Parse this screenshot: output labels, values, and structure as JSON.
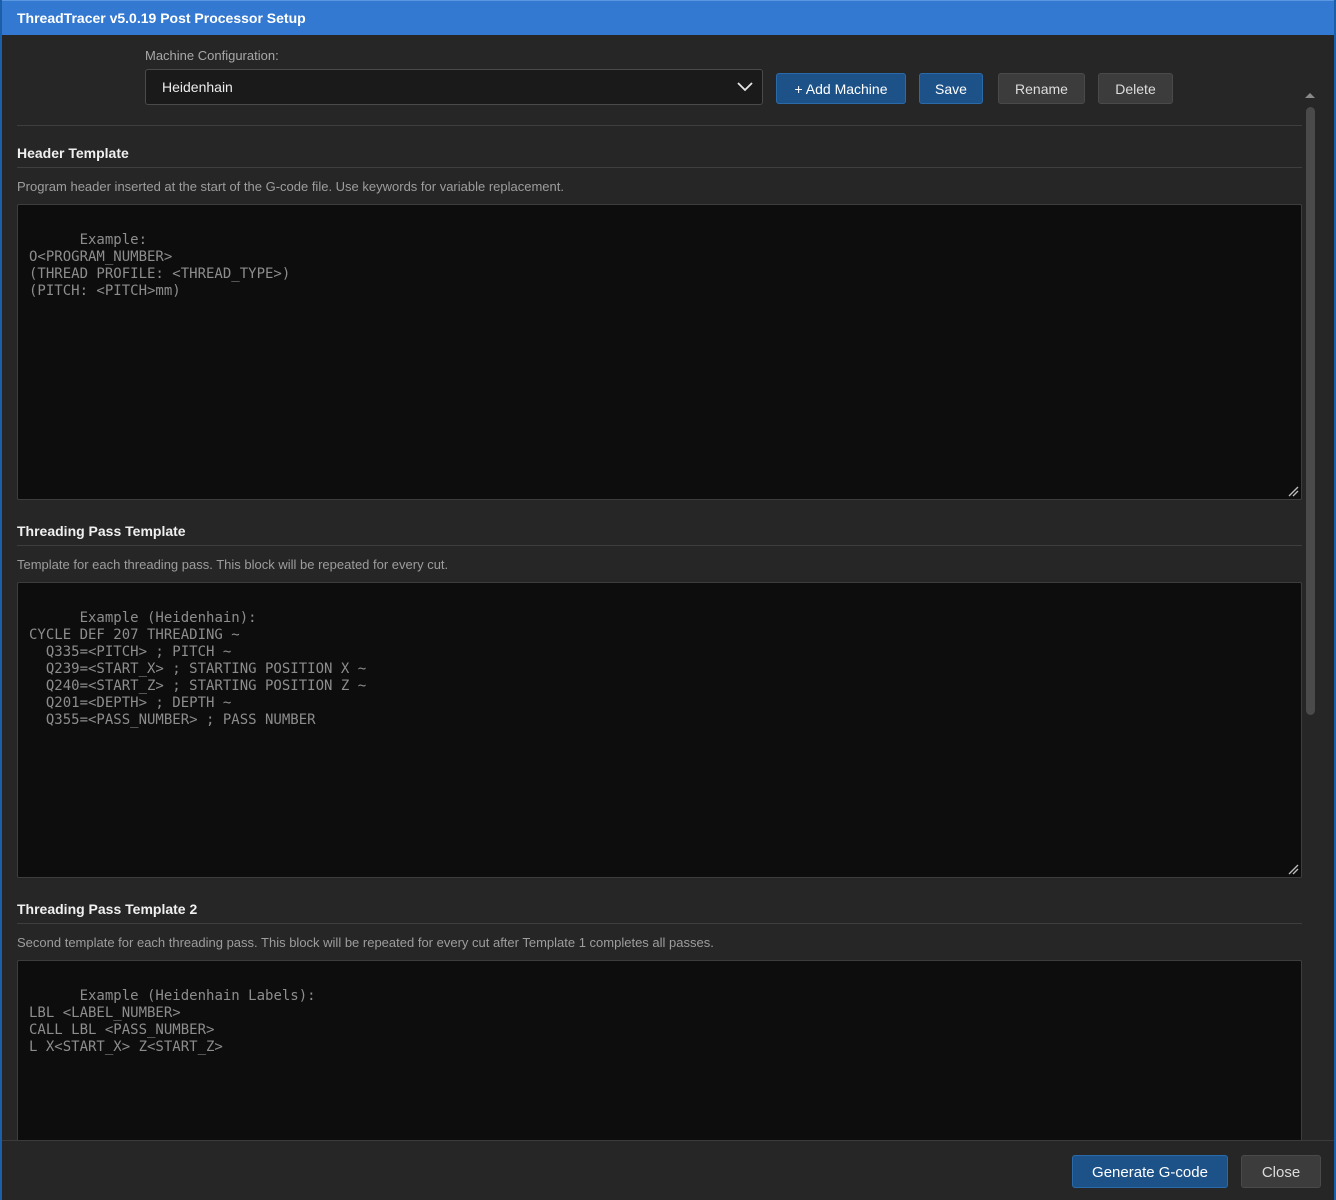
{
  "window": {
    "title": "ThreadTracer v5.0.19 Post Processor Setup"
  },
  "machine_config": {
    "label": "Machine Configuration:",
    "selected": "Heidenhain",
    "add_button": "+ Add Machine",
    "save_button": "Save",
    "rename_button": "Rename",
    "delete_button": "Delete"
  },
  "sections": [
    {
      "title": "Header Template",
      "description": "Program header inserted at the start of the G-code file. Use keywords for variable replacement.",
      "placeholder": "Example:\nO<PROGRAM_NUMBER>\n(THREAD PROFILE: <THREAD_TYPE>)\n(PITCH: <PITCH>mm)"
    },
    {
      "title": "Threading Pass Template",
      "description": "Template for each threading pass. This block will be repeated for every cut.",
      "placeholder": "Example (Heidenhain):\nCYCLE DEF 207 THREADING ~\n  Q335=<PITCH> ; PITCH ~\n  Q239=<START_X> ; STARTING POSITION X ~\n  Q240=<START_Z> ; STARTING POSITION Z ~\n  Q201=<DEPTH> ; DEPTH ~\n  Q355=<PASS_NUMBER> ; PASS NUMBER"
    },
    {
      "title": "Threading Pass Template 2",
      "description": "Second template for each threading pass. This block will be repeated for every cut after Template 1 completes all passes.",
      "placeholder": "Example (Heidenhain Labels):\nLBL <LABEL_NUMBER>\nCALL LBL <PASS_NUMBER>\nL X<START_X> Z<START_Z>"
    }
  ],
  "footer": {
    "generate_button": "Generate G-code",
    "close_button": "Close"
  },
  "icons": {
    "dropdown": "chevron-down-icon",
    "resize": "resize-grip-icon",
    "scroll_up": "triangle-up-icon",
    "scroll_down": "triangle-down-icon"
  }
}
